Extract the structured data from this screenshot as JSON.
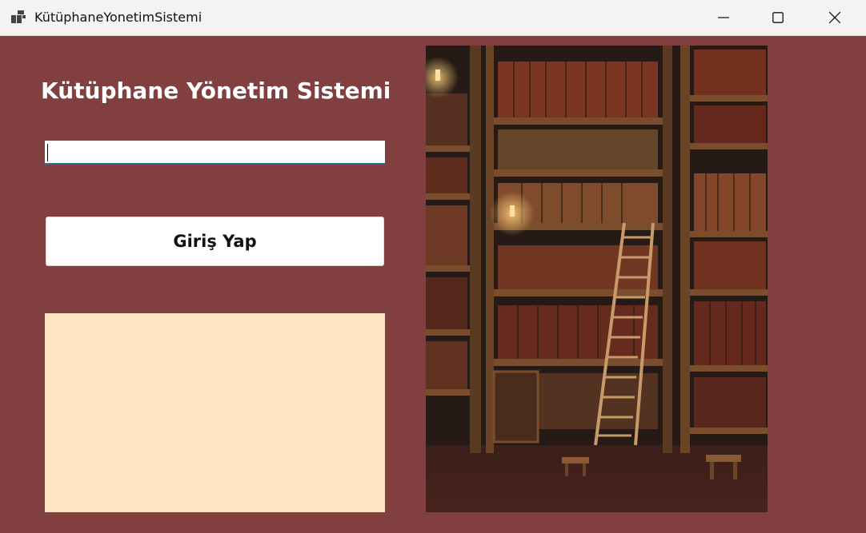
{
  "window": {
    "title": "KütüphaneYonetimSistemi",
    "icons": [
      "app-icon",
      "minimize-icon",
      "maximize-icon",
      "close-icon"
    ]
  },
  "form": {
    "heading": "Kütüphane Yönetim Sistemi",
    "input_value": "",
    "login_button": "Giriş Yap"
  },
  "colors": {
    "form_background": "#813f3f",
    "info_panel": "#ffe4c4",
    "title_bar": "#f3f3f3",
    "input_underline": "#2f6a96"
  }
}
